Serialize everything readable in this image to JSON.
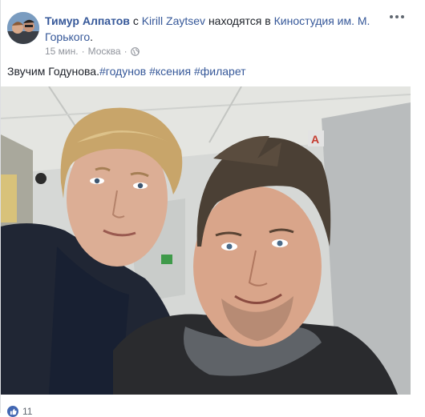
{
  "post": {
    "author": "Тимур Алпатов",
    "with_prefix": "с",
    "tagged_person": "Kirill Zaytsev",
    "location_prefix": "находятся в",
    "location": "Киностудия им. М. Горького",
    "location_suffix": ".",
    "time": "15 мин.",
    "place": "Москва",
    "separator": "·",
    "privacy_icon": "globe-icon",
    "caption_text": "Звучим Годунова.",
    "hashtags": [
      "#годунов",
      "#ксения",
      "#филарет"
    ],
    "photo_icon": "photo-two-men-selfie",
    "reaction_icon": "like-icon",
    "reaction_count": "11"
  },
  "colors": {
    "link": "#365899",
    "meta": "#90949c",
    "like": "#4267b2"
  }
}
